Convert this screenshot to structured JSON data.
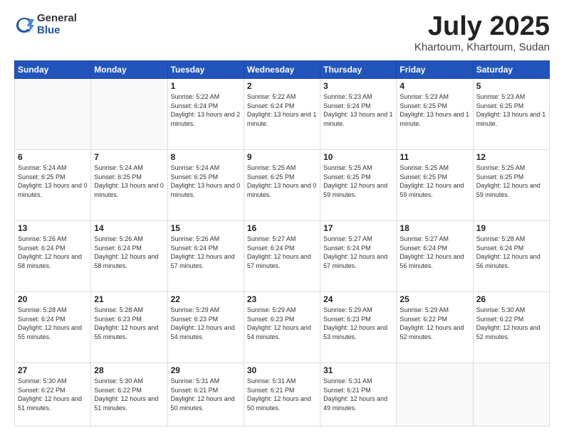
{
  "logo": {
    "general": "General",
    "blue": "Blue"
  },
  "title": {
    "month": "July 2025",
    "location": "Khartoum, Khartoum, Sudan"
  },
  "weekdays": [
    "Sunday",
    "Monday",
    "Tuesday",
    "Wednesday",
    "Thursday",
    "Friday",
    "Saturday"
  ],
  "weeks": [
    [
      {
        "day": "",
        "info": ""
      },
      {
        "day": "",
        "info": ""
      },
      {
        "day": "1",
        "info": "Sunrise: 5:22 AM\nSunset: 6:24 PM\nDaylight: 13 hours\nand 2 minutes."
      },
      {
        "day": "2",
        "info": "Sunrise: 5:22 AM\nSunset: 6:24 PM\nDaylight: 13 hours\nand 1 minute."
      },
      {
        "day": "3",
        "info": "Sunrise: 5:23 AM\nSunset: 6:24 PM\nDaylight: 13 hours\nand 1 minute."
      },
      {
        "day": "4",
        "info": "Sunrise: 5:23 AM\nSunset: 6:25 PM\nDaylight: 13 hours\nand 1 minute."
      },
      {
        "day": "5",
        "info": "Sunrise: 5:23 AM\nSunset: 6:25 PM\nDaylight: 13 hours\nand 1 minute."
      }
    ],
    [
      {
        "day": "6",
        "info": "Sunrise: 5:24 AM\nSunset: 6:25 PM\nDaylight: 13 hours\nand 0 minutes."
      },
      {
        "day": "7",
        "info": "Sunrise: 5:24 AM\nSunset: 6:25 PM\nDaylight: 13 hours\nand 0 minutes."
      },
      {
        "day": "8",
        "info": "Sunrise: 5:24 AM\nSunset: 6:25 PM\nDaylight: 13 hours\nand 0 minutes."
      },
      {
        "day": "9",
        "info": "Sunrise: 5:25 AM\nSunset: 6:25 PM\nDaylight: 13 hours\nand 0 minutes."
      },
      {
        "day": "10",
        "info": "Sunrise: 5:25 AM\nSunset: 6:25 PM\nDaylight: 12 hours\nand 59 minutes."
      },
      {
        "day": "11",
        "info": "Sunrise: 5:25 AM\nSunset: 6:25 PM\nDaylight: 12 hours\nand 59 minutes."
      },
      {
        "day": "12",
        "info": "Sunrise: 5:25 AM\nSunset: 6:25 PM\nDaylight: 12 hours\nand 59 minutes."
      }
    ],
    [
      {
        "day": "13",
        "info": "Sunrise: 5:26 AM\nSunset: 6:24 PM\nDaylight: 12 hours\nand 58 minutes."
      },
      {
        "day": "14",
        "info": "Sunrise: 5:26 AM\nSunset: 6:24 PM\nDaylight: 12 hours\nand 58 minutes."
      },
      {
        "day": "15",
        "info": "Sunrise: 5:26 AM\nSunset: 6:24 PM\nDaylight: 12 hours\nand 57 minutes."
      },
      {
        "day": "16",
        "info": "Sunrise: 5:27 AM\nSunset: 6:24 PM\nDaylight: 12 hours\nand 57 minutes."
      },
      {
        "day": "17",
        "info": "Sunrise: 5:27 AM\nSunset: 6:24 PM\nDaylight: 12 hours\nand 57 minutes."
      },
      {
        "day": "18",
        "info": "Sunrise: 5:27 AM\nSunset: 6:24 PM\nDaylight: 12 hours\nand 56 minutes."
      },
      {
        "day": "19",
        "info": "Sunrise: 5:28 AM\nSunset: 6:24 PM\nDaylight: 12 hours\nand 56 minutes."
      }
    ],
    [
      {
        "day": "20",
        "info": "Sunrise: 5:28 AM\nSunset: 6:24 PM\nDaylight: 12 hours\nand 55 minutes."
      },
      {
        "day": "21",
        "info": "Sunrise: 5:28 AM\nSunset: 6:23 PM\nDaylight: 12 hours\nand 55 minutes."
      },
      {
        "day": "22",
        "info": "Sunrise: 5:29 AM\nSunset: 6:23 PM\nDaylight: 12 hours\nand 54 minutes."
      },
      {
        "day": "23",
        "info": "Sunrise: 5:29 AM\nSunset: 6:23 PM\nDaylight: 12 hours\nand 54 minutes."
      },
      {
        "day": "24",
        "info": "Sunrise: 5:29 AM\nSunset: 6:23 PM\nDaylight: 12 hours\nand 53 minutes."
      },
      {
        "day": "25",
        "info": "Sunrise: 5:29 AM\nSunset: 6:22 PM\nDaylight: 12 hours\nand 52 minutes."
      },
      {
        "day": "26",
        "info": "Sunrise: 5:30 AM\nSunset: 6:22 PM\nDaylight: 12 hours\nand 52 minutes."
      }
    ],
    [
      {
        "day": "27",
        "info": "Sunrise: 5:30 AM\nSunset: 6:22 PM\nDaylight: 12 hours\nand 51 minutes."
      },
      {
        "day": "28",
        "info": "Sunrise: 5:30 AM\nSunset: 6:22 PM\nDaylight: 12 hours\nand 51 minutes."
      },
      {
        "day": "29",
        "info": "Sunrise: 5:31 AM\nSunset: 6:21 PM\nDaylight: 12 hours\nand 50 minutes."
      },
      {
        "day": "30",
        "info": "Sunrise: 5:31 AM\nSunset: 6:21 PM\nDaylight: 12 hours\nand 50 minutes."
      },
      {
        "day": "31",
        "info": "Sunrise: 5:31 AM\nSunset: 6:21 PM\nDaylight: 12 hours\nand 49 minutes."
      },
      {
        "day": "",
        "info": ""
      },
      {
        "day": "",
        "info": ""
      }
    ]
  ]
}
